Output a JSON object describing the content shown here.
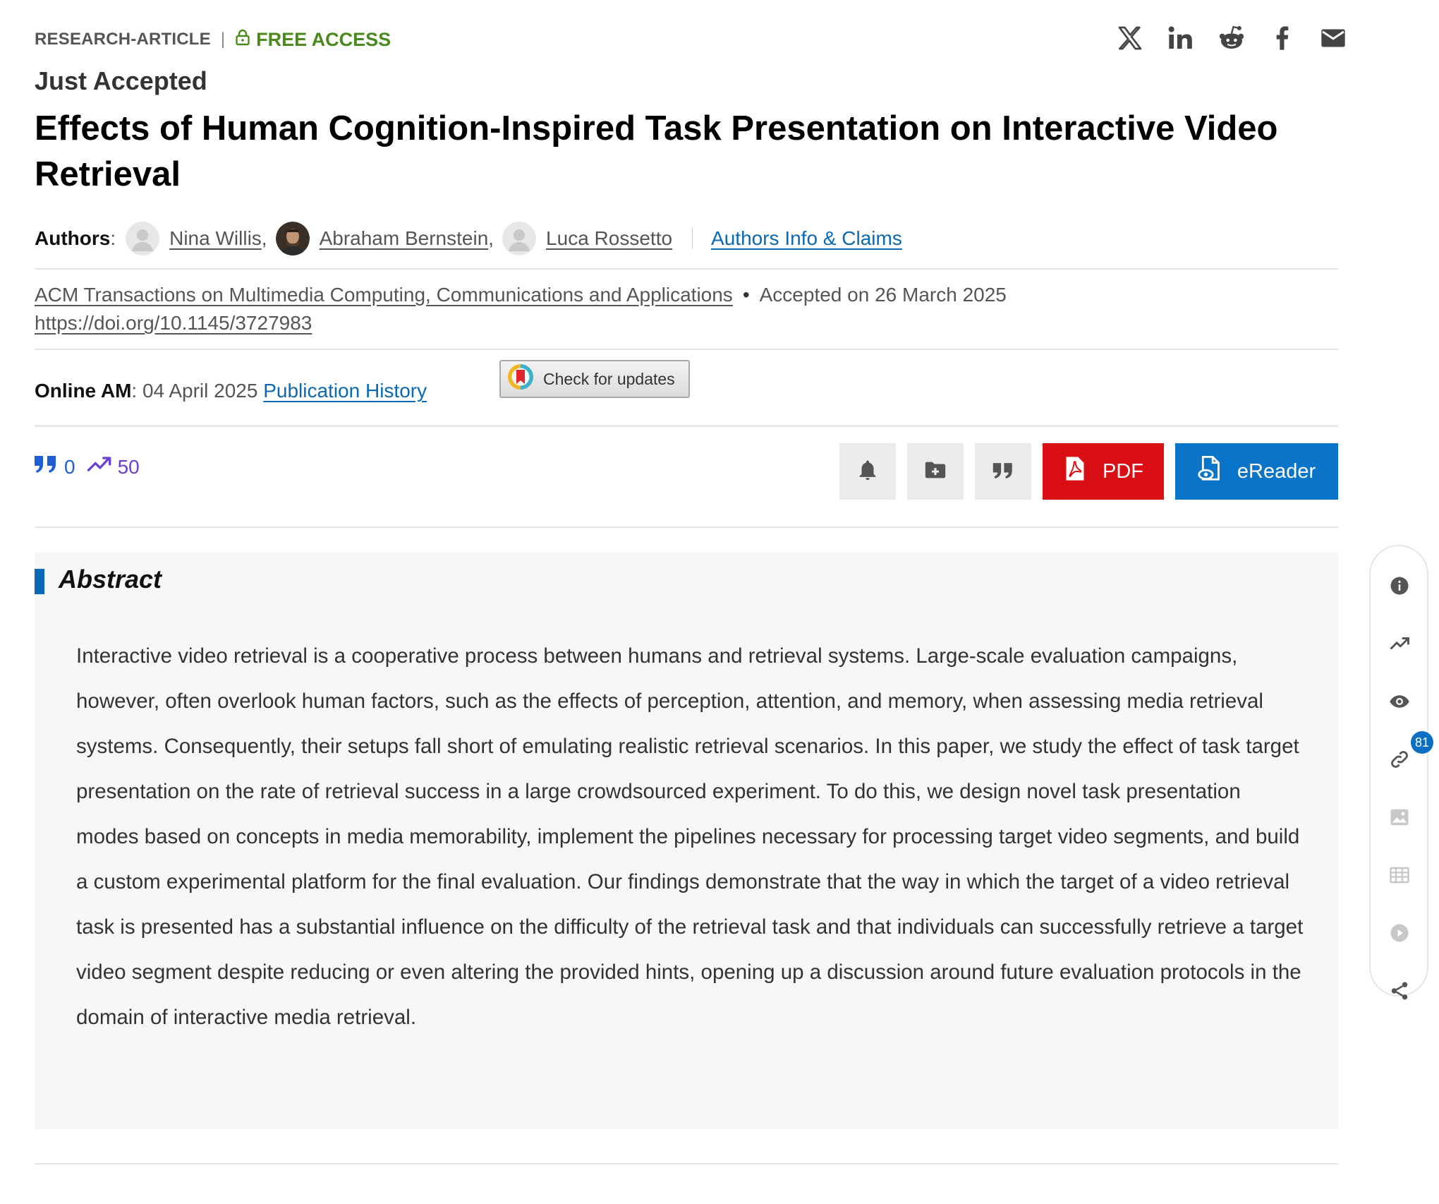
{
  "header": {
    "article_type": "RESEARCH-ARTICLE",
    "separator": "|",
    "access": "FREE ACCESS",
    "status": "Just Accepted",
    "title": "Effects of Human Cognition-Inspired Task Presentation on Interactive Video Retrieval"
  },
  "share": [
    "x-icon",
    "linkedin-icon",
    "reddit-icon",
    "facebook-icon",
    "email-icon"
  ],
  "authors": {
    "label": "Authors",
    "colon": ":",
    "list": [
      {
        "name": "Nina Willis",
        "sep": ","
      },
      {
        "name": "Abraham Bernstein",
        "sep": ","
      },
      {
        "name": "Luca Rossetto",
        "sep": ""
      }
    ],
    "info_link": "Authors Info & Claims"
  },
  "publication": {
    "journal": "ACM Transactions on Multimedia Computing, Communications and Applications",
    "bullet": "•",
    "accepted": "Accepted on 26 March 2025",
    "doi": "https://doi.org/10.1145/3727983",
    "online_label": "Online AM",
    "online_date": ": 04 April 2025 ",
    "history_link": "Publication History",
    "check_updates": "Check for updates"
  },
  "metrics": {
    "citations": "0",
    "downloads": "50"
  },
  "actions": {
    "pdf": "PDF",
    "ereader": "eReader"
  },
  "abstract": {
    "heading": "Abstract",
    "text": "Interactive video retrieval is a cooperative process between humans and retrieval systems. Large-scale evaluation campaigns, however, often overlook human factors, such as the effects of perception, attention, and memory, when assessing media retrieval systems. Consequently, their setups fall short of emulating realistic retrieval scenarios. In this paper, we study the effect of task target presentation on the rate of retrieval success in a large crowdsourced experiment. To do this, we design novel task presentation modes based on concepts in media memorability, implement the pipelines necessary for processing target video segments, and build a custom experimental platform for the final evaluation. Our findings demonstrate that the way in which the target of a video retrieval task is presented has a substantial influence on the difficulty of the retrieval task and that individuals can successfully retrieve a target video segment despite reducing or even altering the provided hints, opening up a discussion around future evaluation protocols in the domain of interactive media retrieval."
  },
  "rail": {
    "references_count": "81"
  },
  "colors": {
    "accent_blue": "#0a69b6",
    "pdf_red": "#d90f15",
    "ereader_blue": "#0a74c9",
    "free_green": "#4a8a1c",
    "metric_purple": "#6b3fd4"
  }
}
